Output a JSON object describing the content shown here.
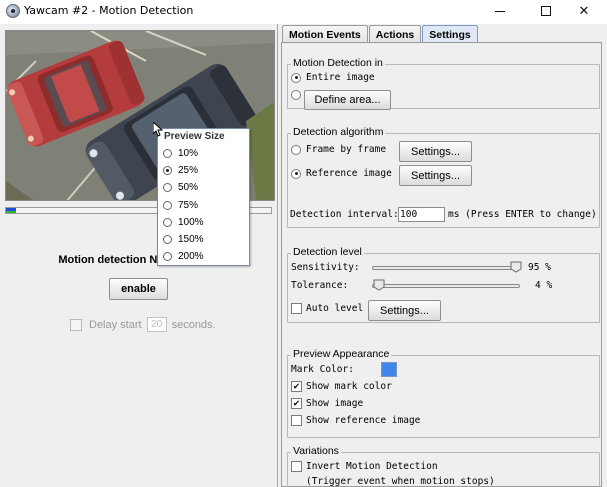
{
  "window": {
    "title": "Yawcam #2 - Motion Detection",
    "minimize_symbol": "—",
    "maximize_symbol": "☐",
    "close_symbol": "✕"
  },
  "left": {
    "status": "Motion detection NOT running.",
    "enable_label": "enable",
    "delay_label": "Delay start",
    "delay_value": "20",
    "delay_unit": "seconds.",
    "level_fraction": 0.04
  },
  "preview_popup": {
    "title": "Preview Size",
    "options": [
      "10%",
      "25%",
      "50%",
      "75%",
      "100%",
      "150%",
      "200%"
    ],
    "selected": "25%"
  },
  "tabs": [
    "Motion Events",
    "Actions",
    "Settings"
  ],
  "active_tab": "Settings",
  "settings": {
    "motion_detection_in": {
      "title": "Motion Detection in",
      "entire_image_label": "Entire image",
      "define_area_label": "Define area...",
      "selected": "Entire image"
    },
    "detection_algorithm": {
      "title": "Detection algorithm",
      "frame_by_frame_label": "Frame by frame",
      "reference_image_label": "Reference image",
      "settings_label": "Settings...",
      "selected": "Reference image",
      "interval_label": "Detection interval:",
      "interval_value": "100",
      "interval_hint": "ms (Press ENTER to change)"
    },
    "detection_level": {
      "title": "Detection level",
      "sensitivity_label": "Sensitivity:",
      "sensitivity_value": "95 %",
      "tolerance_label": "Tolerance:",
      "tolerance_value": "4 %",
      "auto_level_label": "Auto level",
      "settings_label": "Settings...",
      "sensitivity": 95,
      "tolerance": 4
    },
    "preview_appearance": {
      "title": "Preview Appearance",
      "mark_color_label": "Mark Color:",
      "mark_color": "#3f86e8",
      "show_mark_color_label": "Show mark color",
      "show_image_label": "Show image",
      "show_reference_label": "Show reference image"
    },
    "variations": {
      "title": "Variations",
      "invert_label": "Invert Motion Detection",
      "invert_hint": "(Trigger event when motion stops)"
    }
  },
  "colors": {
    "active_tab": "#dfe8f4",
    "window_bg": "#efefef",
    "level_blue": "#1e4fd9",
    "level_green": "#2eb82e"
  }
}
